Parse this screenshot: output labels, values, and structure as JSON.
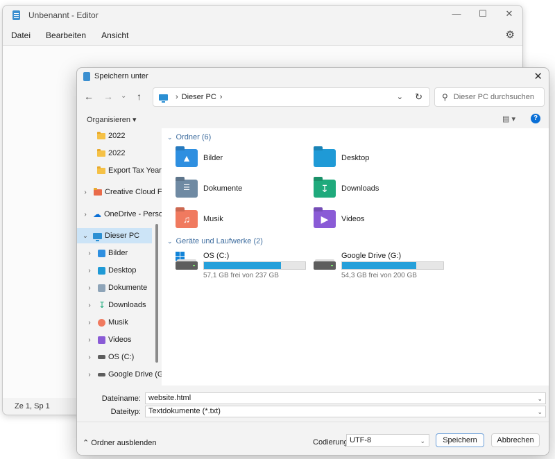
{
  "editor": {
    "title": "Unbenannt - Editor",
    "menu": [
      "Datei",
      "Bearbeiten",
      "Ansicht"
    ],
    "status": "Ze 1, Sp 1"
  },
  "dialog": {
    "title": "Speichern unter",
    "address": {
      "location": "Dieser PC"
    },
    "search_placeholder": "Dieser PC durchsuchen",
    "organize_label": "Organisieren",
    "help_label": "?",
    "tree": [
      {
        "label": "2022"
      },
      {
        "label": "2022"
      },
      {
        "label": "Export Tax Year"
      },
      {
        "label": "Creative Cloud Fi"
      },
      {
        "label": "OneDrive - Perso"
      },
      {
        "label": "Dieser PC"
      },
      {
        "label": "Bilder"
      },
      {
        "label": "Desktop"
      },
      {
        "label": "Dokumente"
      },
      {
        "label": "Downloads"
      },
      {
        "label": "Musik"
      },
      {
        "label": "Videos"
      },
      {
        "label": "OS (C:)"
      },
      {
        "label": "Google Drive (G"
      }
    ],
    "folders_group": "Ordner (6)",
    "folders": [
      {
        "name": "Bilder",
        "color": "#2e8fe0"
      },
      {
        "name": "Desktop",
        "color": "#1f9ad6"
      },
      {
        "name": "Dokumente",
        "color": "#6f8aa3"
      },
      {
        "name": "Downloads",
        "color": "#1faa7c"
      },
      {
        "name": "Musik",
        "color": "#f07a5f"
      },
      {
        "name": "Videos",
        "color": "#8a5bd6"
      }
    ],
    "drives_group": "Geräte und Laufwerke (2)",
    "drives": [
      {
        "name": "OS (C:)",
        "free": "57,1 GB frei von 237 GB",
        "used_fraction": 0.76
      },
      {
        "name": "Google Drive (G:)",
        "free": "54,3 GB frei von 200 GB",
        "used_fraction": 0.73
      }
    ],
    "filename_label": "Dateiname:",
    "filename_value": "website.html",
    "filetype_label": "Dateityp:",
    "filetype_value": "Textdokumente (*.txt)",
    "hide_folders": "Ordner ausblenden",
    "encoding_label": "Codierung:",
    "encoding_value": "UTF-8",
    "save_button": "Speichern",
    "cancel_button": "Abbrechen"
  }
}
